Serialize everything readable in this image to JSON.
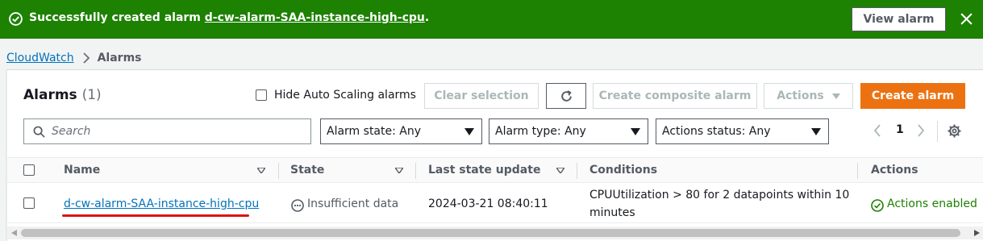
{
  "flash": {
    "message_prefix": "Successfully created alarm ",
    "alarm_name": "d-cw-alarm-SAA-instance-high-cpu",
    "message_suffix": ".",
    "view_button": "View alarm",
    "color": "#1d8102"
  },
  "breadcrumb": {
    "root": "CloudWatch",
    "current": "Alarms"
  },
  "header": {
    "title": "Alarms",
    "count": "(1)",
    "hide_autoscaling_label": "Hide Auto Scaling alarms",
    "clear_selection": "Clear selection",
    "create_composite": "Create composite alarm",
    "actions": "Actions",
    "create_alarm": "Create alarm",
    "accent_color": "#ec7211"
  },
  "filters": {
    "search_placeholder": "Search",
    "alarm_state": "Alarm state: Any",
    "alarm_type": "Alarm type: Any",
    "actions_status": "Actions status: Any"
  },
  "pagination": {
    "current_page": "1"
  },
  "table": {
    "columns": [
      "Name",
      "State",
      "Last state update",
      "Conditions",
      "Actions"
    ],
    "rows": [
      {
        "name": "d-cw-alarm-SAA-instance-high-cpu",
        "state": "Insufficient data",
        "last_update": "2024-03-21 08:40:11",
        "conditions_line1": "CPUUtilization > 80 for 2 datapoints within 10",
        "conditions_line2": "minutes",
        "actions": "Actions enabled"
      }
    ]
  },
  "icons": {
    "flash_icon": "check-circle-icon",
    "close": "close-icon",
    "refresh": "refresh-icon",
    "search": "search-icon",
    "settings": "gear-icon",
    "state": "ellipsis-circle-icon",
    "actions_status": "check-circle-icon"
  }
}
